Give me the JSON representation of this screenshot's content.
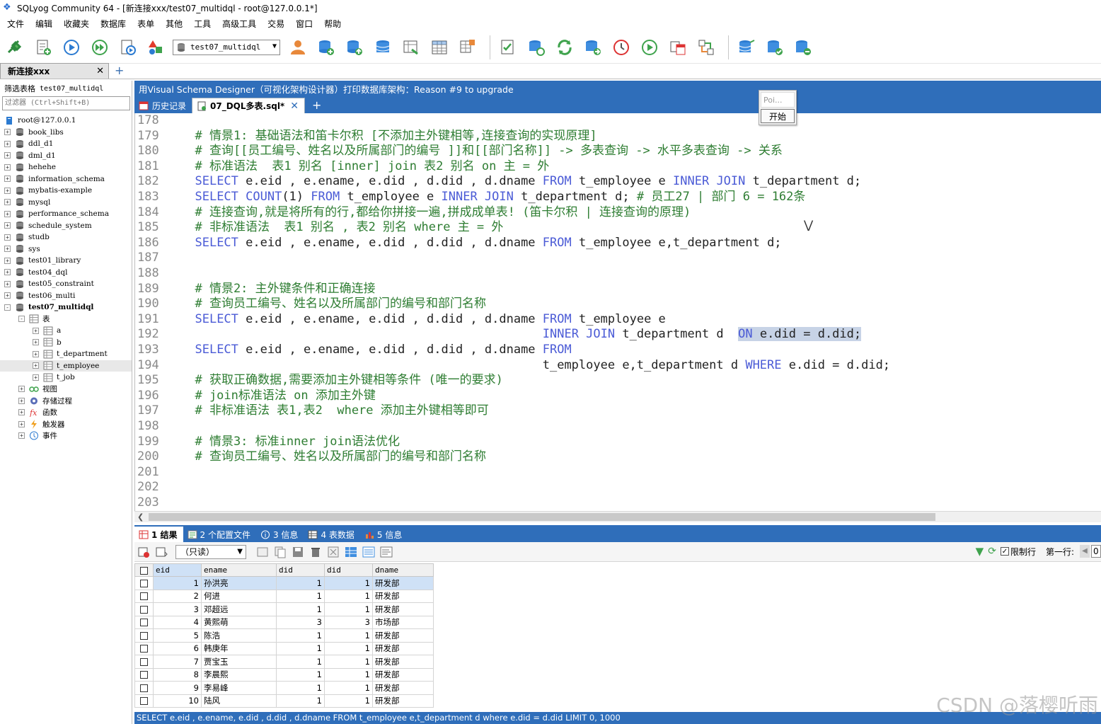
{
  "window": {
    "title": "SQLyog Community 64 - [新连接xxx/test07_multidql - root@127.0.0.1*]"
  },
  "menu": [
    "文件",
    "编辑",
    "收藏夹",
    "数据库",
    "表单",
    "其他",
    "工具",
    "高级工具",
    "交易",
    "窗口",
    "帮助"
  ],
  "toolbar": {
    "database_selected": "test07_multidql"
  },
  "connection_tab": {
    "label": "新连接xxx"
  },
  "left_panel": {
    "filter_label": "筛选表格",
    "filter_db": "test07_multidql",
    "filter_placeholder": "过滤器 (Ctrl+Shift+B)",
    "tree": [
      {
        "label": "root@127.0.0.1",
        "level": 0,
        "icon": "server-icon",
        "expander": ""
      },
      {
        "label": "book_libs",
        "level": 0,
        "icon": "database-icon",
        "expander": "+"
      },
      {
        "label": "ddl_d1",
        "level": 0,
        "icon": "database-icon",
        "expander": "+"
      },
      {
        "label": "dml_d1",
        "level": 0,
        "icon": "database-icon",
        "expander": "+"
      },
      {
        "label": "hehehe",
        "level": 0,
        "icon": "database-icon",
        "expander": "+"
      },
      {
        "label": "information_schema",
        "level": 0,
        "icon": "database-icon",
        "expander": "+"
      },
      {
        "label": "mybatis-example",
        "level": 0,
        "icon": "database-icon",
        "expander": "+"
      },
      {
        "label": "mysql",
        "level": 0,
        "icon": "database-icon",
        "expander": "+"
      },
      {
        "label": "performance_schema",
        "level": 0,
        "icon": "database-icon",
        "expander": "+"
      },
      {
        "label": "schedule_system",
        "level": 0,
        "icon": "database-icon",
        "expander": "+"
      },
      {
        "label": "studb",
        "level": 0,
        "icon": "database-icon",
        "expander": "+"
      },
      {
        "label": "sys",
        "level": 0,
        "icon": "database-icon",
        "expander": "+"
      },
      {
        "label": "test01_library",
        "level": 0,
        "icon": "database-icon",
        "expander": "+"
      },
      {
        "label": "test04_dql",
        "level": 0,
        "icon": "database-icon",
        "expander": "+"
      },
      {
        "label": "test05_constraint",
        "level": 0,
        "icon": "database-icon",
        "expander": "+"
      },
      {
        "label": "test06_multi",
        "level": 0,
        "icon": "database-icon",
        "expander": "+"
      },
      {
        "label": "test07_multidql",
        "level": 0,
        "icon": "database-icon",
        "expander": "-",
        "bold": true
      },
      {
        "label": "表",
        "level": 1,
        "icon": "table-folder-icon",
        "expander": "-"
      },
      {
        "label": "a",
        "level": 2,
        "icon": "table-icon",
        "expander": "+"
      },
      {
        "label": "b",
        "level": 2,
        "icon": "table-icon",
        "expander": "+"
      },
      {
        "label": "t_department",
        "level": 2,
        "icon": "table-icon",
        "expander": "+"
      },
      {
        "label": "t_employee",
        "level": 2,
        "icon": "table-icon",
        "expander": "+",
        "selected": true
      },
      {
        "label": "t_job",
        "level": 2,
        "icon": "table-icon",
        "expander": "+"
      },
      {
        "label": "视图",
        "level": 1,
        "icon": "view-icon",
        "expander": "+"
      },
      {
        "label": "存储过程",
        "level": 1,
        "icon": "procedure-icon",
        "expander": "+"
      },
      {
        "label": "函数",
        "level": 1,
        "icon": "function-icon",
        "expander": "+"
      },
      {
        "label": "触发器",
        "level": 1,
        "icon": "trigger-icon",
        "expander": "+"
      },
      {
        "label": "事件",
        "level": 1,
        "icon": "event-icon",
        "expander": "+"
      }
    ]
  },
  "editor": {
    "banner": "用Visual Schema Designer（可视化架构设计器）打印数据库架构：Reason #9 to upgrade",
    "tabs": [
      {
        "label": "历史记录",
        "active": false
      },
      {
        "label": "07_DQL多表.sql*",
        "active": true
      }
    ],
    "popup": {
      "input": "Poi...",
      "button": "开始"
    },
    "lines": [
      {
        "n": "178",
        "seg": []
      },
      {
        "n": "179",
        "seg": [
          [
            "cm",
            "  # 情景1: 基础语法和笛卡尔积 [不添加主外键相等,连接查询的实现原理]"
          ]
        ]
      },
      {
        "n": "180",
        "seg": [
          [
            "cm",
            "  # 查询[[员工编号、姓名以及所属部门的编号 ]]和[[部门名称]] -> 多表查询 -> 水平多表查询 -> 关系"
          ]
        ]
      },
      {
        "n": "181",
        "seg": [
          [
            "cm",
            "  # 标准语法  表1 别名 [inner] join 表2 别名 on 主 = 外"
          ]
        ]
      },
      {
        "n": "182",
        "seg": [
          [
            "pl",
            "  "
          ],
          [
            "kw",
            "SELECT"
          ],
          [
            "pl",
            " e.eid , e.ename, e.did , d.did , d.dname "
          ],
          [
            "kw",
            "FROM"
          ],
          [
            "pl",
            " t_employee e "
          ],
          [
            "kw",
            "INNER JOIN"
          ],
          [
            "pl",
            " t_department d;"
          ]
        ]
      },
      {
        "n": "183",
        "seg": [
          [
            "pl",
            "  "
          ],
          [
            "kw",
            "SELECT COUNT"
          ],
          [
            "pl",
            "(1) "
          ],
          [
            "kw",
            "FROM"
          ],
          [
            "pl",
            " t_employee e "
          ],
          [
            "kw",
            "INNER JOIN"
          ],
          [
            "pl",
            " t_department d; "
          ],
          [
            "cm",
            "# 员工27 | 部门 6 = 162条"
          ]
        ]
      },
      {
        "n": "184",
        "seg": [
          [
            "cm",
            "  # 连接查询,就是将所有的行,都给你拼接一遍,拼成成单表! (笛卡尔积 | 连接查询的原理)"
          ]
        ]
      },
      {
        "n": "185",
        "seg": [
          [
            "cm",
            "  # 非标准语法  表1 别名 , 表2 别名 where 主 = 外"
          ]
        ]
      },
      {
        "n": "186",
        "seg": [
          [
            "pl",
            "  "
          ],
          [
            "kw",
            "SELECT"
          ],
          [
            "pl",
            " e.eid , e.ename, e.did , d.did , d.dname "
          ],
          [
            "kw",
            "FROM"
          ],
          [
            "pl",
            " t_employee e,t_department d;"
          ]
        ]
      },
      {
        "n": "187",
        "seg": []
      },
      {
        "n": "188",
        "seg": []
      },
      {
        "n": "189",
        "seg": [
          [
            "cm",
            "  # 情景2: 主外键条件和正确连接"
          ]
        ]
      },
      {
        "n": "190",
        "seg": [
          [
            "cm",
            "  # 查询员工编号、姓名以及所属部门的编号和部门名称"
          ]
        ]
      },
      {
        "n": "191",
        "seg": [
          [
            "pl",
            "  "
          ],
          [
            "kw",
            "SELECT"
          ],
          [
            "pl",
            " e.eid , e.ename, e.did , d.did , d.dname "
          ],
          [
            "kw",
            "FROM"
          ],
          [
            "pl",
            " t_employee e"
          ]
        ]
      },
      {
        "n": "192",
        "seg": [
          [
            "pl",
            "                                                  "
          ],
          [
            "kw",
            "INNER JOIN"
          ],
          [
            "pl",
            " t_department d  "
          ],
          [
            "kwsel",
            "ON"
          ],
          [
            "plsel",
            " e.did = d.did;"
          ]
        ]
      },
      {
        "n": "193",
        "seg": [
          [
            "pl",
            "  "
          ],
          [
            "kw",
            "SELECT"
          ],
          [
            "pl",
            " e.eid , e.ename, e.did , d.did , d.dname "
          ],
          [
            "kw",
            "FROM"
          ]
        ]
      },
      {
        "n": "194",
        "seg": [
          [
            "pl",
            "                                                  t_employee e,t_department d "
          ],
          [
            "kw",
            "WHERE"
          ],
          [
            "pl",
            " e.did = d.did;"
          ]
        ]
      },
      {
        "n": "195",
        "seg": [
          [
            "cm",
            "  # 获取正确数据,需要添加主外键相等条件 (唯一的要求)"
          ]
        ]
      },
      {
        "n": "196",
        "seg": [
          [
            "cm",
            "  # join标准语法 on 添加主外键"
          ]
        ]
      },
      {
        "n": "197",
        "seg": [
          [
            "cm",
            "  # 非标准语法 表1,表2  where 添加主外键相等即可"
          ]
        ]
      },
      {
        "n": "198",
        "seg": []
      },
      {
        "n": "199",
        "seg": [
          [
            "cm",
            "  # 情景3: 标准inner join语法优化"
          ]
        ]
      },
      {
        "n": "200",
        "seg": [
          [
            "cm",
            "  # 查询员工编号、姓名以及所属部门的编号和部门名称"
          ]
        ]
      },
      {
        "n": "201",
        "seg": []
      },
      {
        "n": "202",
        "seg": []
      },
      {
        "n": "203",
        "seg": []
      }
    ]
  },
  "result_tabs": [
    {
      "label": "1 结果",
      "active": true
    },
    {
      "label": "2 个配置文件",
      "active": false
    },
    {
      "label": "3 信息",
      "active": false
    },
    {
      "label": "4 表数据",
      "active": false
    },
    {
      "label": "5 信息",
      "active": false
    }
  ],
  "result_toolbar": {
    "mode": "（只读）",
    "limit_label": "限制行",
    "first_row_label": "第一行:",
    "first_row_value": "0"
  },
  "result_grid": {
    "columns": [
      "eid",
      "ename",
      "did",
      "did",
      "dname"
    ],
    "rows": [
      [
        "1",
        "孙洪亮",
        "1",
        "1",
        "研发部"
      ],
      [
        "2",
        "何进",
        "1",
        "1",
        "研发部"
      ],
      [
        "3",
        "邓超远",
        "1",
        "1",
        "研发部"
      ],
      [
        "4",
        "黄熙萌",
        "3",
        "3",
        "市场部"
      ],
      [
        "5",
        "陈浩",
        "1",
        "1",
        "研发部"
      ],
      [
        "6",
        "韩庚年",
        "1",
        "1",
        "研发部"
      ],
      [
        "7",
        "贾宝玉",
        "1",
        "1",
        "研发部"
      ],
      [
        "8",
        "李晨熙",
        "1",
        "1",
        "研发部"
      ],
      [
        "9",
        "李易峰",
        "1",
        "1",
        "研发部"
      ],
      [
        "10",
        "陆风",
        "1",
        "1",
        "研发部"
      ]
    ]
  },
  "status_bar": {
    "text": "SELECT e.eid , e.ename, e.did , d.did , d.dname FROM t_employee e,t_department d where e.did = d.did LIMIT 0, 1000"
  },
  "watermark": "CSDN @落樱听雨",
  "colors": {
    "accent": "#2f6eba",
    "keyword": "#4b5bd6",
    "comment": "#2e7d32",
    "selection": "#c7d3e6"
  }
}
